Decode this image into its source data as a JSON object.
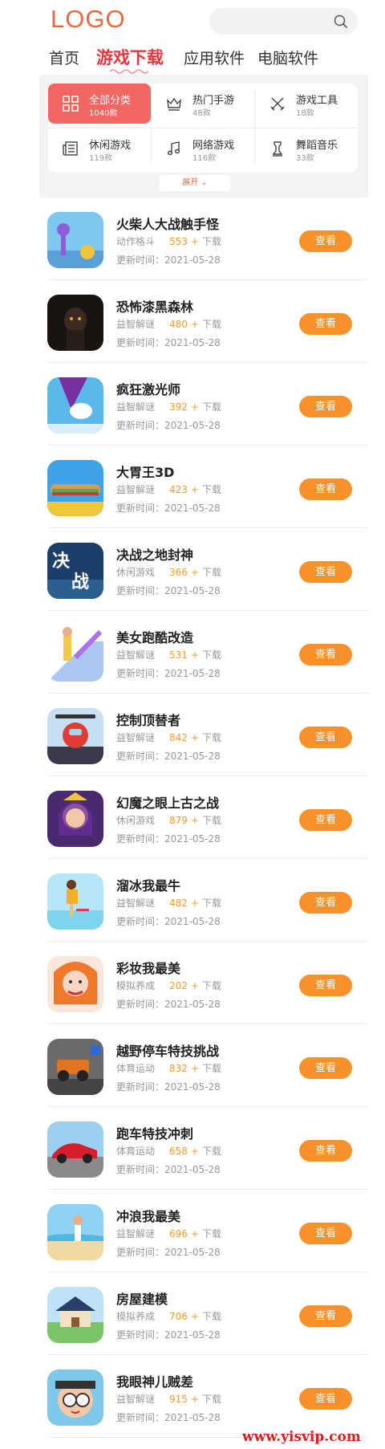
{
  "header": {
    "logo": "LOGO"
  },
  "nav": {
    "tabs": [
      "首页",
      "游戏下载",
      "应用软件",
      "电脑软件"
    ]
  },
  "categories": [
    {
      "name": "全部分类",
      "count": "1040款",
      "icon": "grid-icon"
    },
    {
      "name": "热门手游",
      "count": "48款",
      "icon": "crown-icon"
    },
    {
      "name": "游戏工具",
      "count": "18款",
      "icon": "swords-icon"
    },
    {
      "name": "休闲游戏",
      "count": "119款",
      "icon": "newspaper-icon"
    },
    {
      "name": "网络游戏",
      "count": "116款",
      "icon": "music-note-icon"
    },
    {
      "name": "舞蹈音乐",
      "count": "33款",
      "icon": "chess-icon"
    }
  ],
  "expand_label": "展开",
  "labels": {
    "download": "下载",
    "plus": "+",
    "date_prefix": "更新时间：",
    "view": "查看"
  },
  "apps": [
    {
      "title": "火柴人大战触手怪",
      "category": "动作格斗",
      "downloads": "553",
      "date": "2021-05-28"
    },
    {
      "title": "恐怖漆黑森林",
      "category": "益智解谜",
      "downloads": "480",
      "date": "2021-05-28"
    },
    {
      "title": "疯狂激光师",
      "category": "益智解谜",
      "downloads": "392",
      "date": "2021-05-28"
    },
    {
      "title": "大胃王3D",
      "category": "益智解谜",
      "downloads": "423",
      "date": "2021-05-28"
    },
    {
      "title": "决战之地封神",
      "category": "休闲游戏",
      "downloads": "366",
      "date": "2021-05-28"
    },
    {
      "title": "美女跑酷改造",
      "category": "益智解谜",
      "downloads": "531",
      "date": "2021-05-28"
    },
    {
      "title": "控制顶替者",
      "category": "益智解谜",
      "downloads": "842",
      "date": "2021-05-28"
    },
    {
      "title": "幻魔之眼上古之战",
      "category": "休闲游戏",
      "downloads": "879",
      "date": "2021-05-28"
    },
    {
      "title": "溜冰我最牛",
      "category": "益智解谜",
      "downloads": "482",
      "date": "2021-05-28"
    },
    {
      "title": "彩妆我最美",
      "category": "模拟养成",
      "downloads": "202",
      "date": "2021-05-28"
    },
    {
      "title": "越野停车特技挑战",
      "category": "体育运动",
      "downloads": "832",
      "date": "2021-05-28"
    },
    {
      "title": "跑车特技冲刺",
      "category": "体育运动",
      "downloads": "658",
      "date": "2021-05-28"
    },
    {
      "title": "冲浪我最美",
      "category": "益智解谜",
      "downloads": "696",
      "date": "2021-05-28"
    },
    {
      "title": "房屋建模",
      "category": "模拟养成",
      "downloads": "706",
      "date": "2021-05-28"
    },
    {
      "title": "我眼神儿贼差",
      "category": "益智解谜",
      "downloads": "915",
      "date": "2021-05-28"
    }
  ],
  "watermark": "www.yisvip.com",
  "colors": {
    "brand": "#f0663e",
    "active_tab": "#e8373c",
    "button": "#f7922a",
    "active_category": "#f36662"
  }
}
